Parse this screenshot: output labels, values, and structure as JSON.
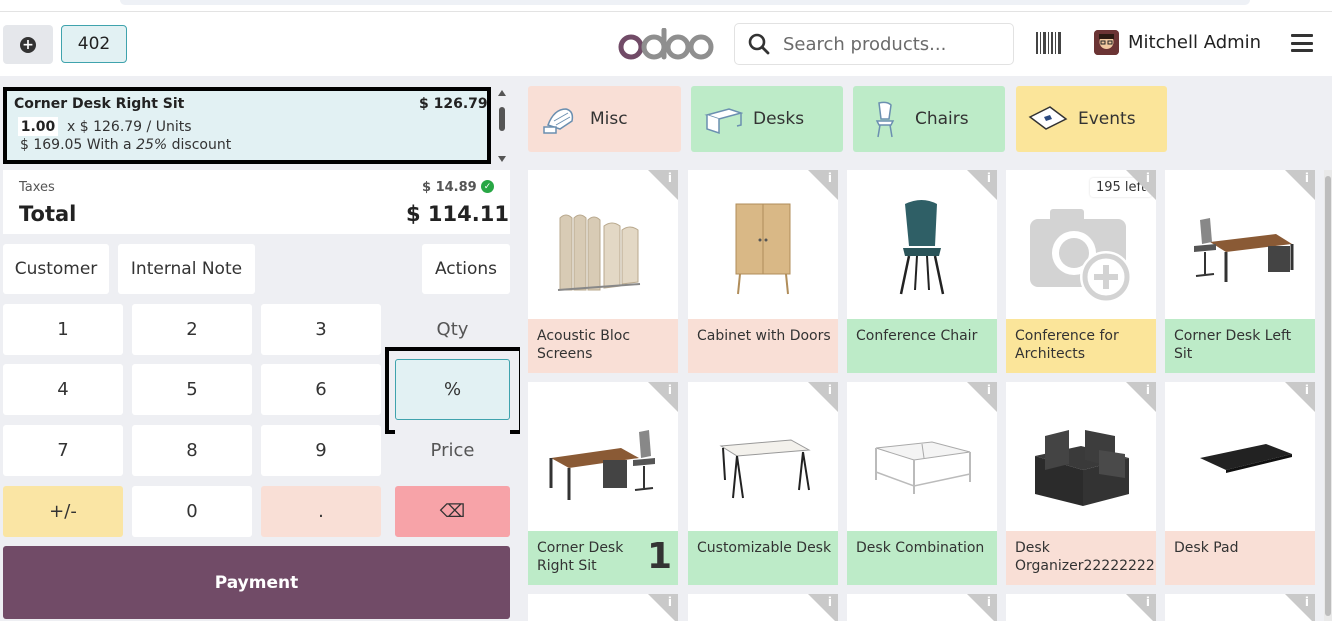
{
  "header": {
    "order_number": "402",
    "search_placeholder": "Search products...",
    "user_name": "Mitchell Admin",
    "logo_text": "odoo"
  },
  "orderline": {
    "name": "Corner Desk Right Sit",
    "price": "$ 126.79",
    "qty": "1.00",
    "unit_text": "x $ 126.79 / Units",
    "discount_prefix": "$ 169.05 With a ",
    "discount_pct": "25%",
    "discount_suffix": " discount"
  },
  "totals": {
    "taxes_label": "Taxes",
    "taxes_value": "$ 14.89",
    "total_label": "Total",
    "total_value": "$ 114.11"
  },
  "controls": {
    "customer": "Customer",
    "note": "Internal Note",
    "actions": "Actions"
  },
  "numpad": {
    "k1": "1",
    "k2": "2",
    "k3": "3",
    "qty": "Qty",
    "k4": "4",
    "k5": "5",
    "k6": "6",
    "pct": "%",
    "k7": "7",
    "k8": "8",
    "k9": "9",
    "price": "Price",
    "plusminus": "+/-",
    "k0": "0",
    "dot": ".",
    "backspace": "⌫"
  },
  "payment_label": "Payment",
  "categories": [
    {
      "label": "Misc",
      "color": "#f9dfd6"
    },
    {
      "label": "Desks",
      "color": "#bdebc8"
    },
    {
      "label": "Chairs",
      "color": "#bdebc8"
    },
    {
      "label": "Events",
      "color": "#fbe59a"
    }
  ],
  "products": [
    {
      "name": "Acoustic Bloc",
      "name2": "Screens"
    },
    {
      "name": "Cabinet with Doors",
      "name2": ""
    },
    {
      "name": "Conference Chair",
      "name2": ""
    },
    {
      "name": "Conference for",
      "name2": "Architects",
      "stock": "195 left"
    },
    {
      "name": "Corner Desk Left",
      "name2": "Sit"
    },
    {
      "name": "Corner Desk",
      "name2": "Right Sit",
      "qty": "1"
    },
    {
      "name": "Customizable Desk",
      "name2": ""
    },
    {
      "name": "Desk Combination",
      "name2": ""
    },
    {
      "name": "Desk",
      "name2": "Organizer22222222"
    },
    {
      "name": "Desk Pad",
      "name2": ""
    }
  ],
  "info_icon": "i"
}
